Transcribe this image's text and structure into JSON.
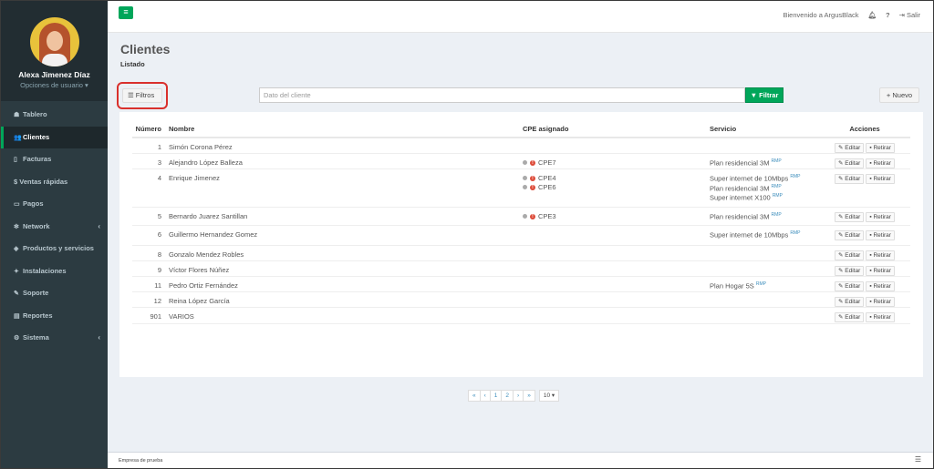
{
  "user": {
    "name": "Alexa Jimenez Díaz",
    "options_label": "Opciones de usuario ▾"
  },
  "sidebar": {
    "items": [
      {
        "label": "Tablero",
        "icon": "dashboard-icon",
        "glyph": "☗"
      },
      {
        "label": "Clientes",
        "icon": "users-icon",
        "glyph": "👥",
        "active": true
      },
      {
        "label": "Facturas",
        "icon": "file-icon",
        "glyph": "▯"
      },
      {
        "label": "$ Ventas rápidas",
        "icon": "",
        "glyph": ""
      },
      {
        "label": "Pagos",
        "icon": "money-icon",
        "glyph": "▭"
      },
      {
        "label": "Network",
        "icon": "network-icon",
        "glyph": "✻",
        "chevron": "‹"
      },
      {
        "label": "Productos y servicios",
        "icon": "tag-icon",
        "glyph": "◈"
      },
      {
        "label": "Instalaciones",
        "icon": "plug-icon",
        "glyph": "✦"
      },
      {
        "label": "Soporte",
        "icon": "wrench-icon",
        "glyph": "✎"
      },
      {
        "label": "Reportes",
        "icon": "report-icon",
        "glyph": "▤"
      },
      {
        "label": "Sistema",
        "icon": "cogs-icon",
        "glyph": "⚙",
        "chevron": "‹"
      }
    ]
  },
  "header": {
    "menu_glyph": "≡",
    "welcome": "Bienvenido a ArgusBlack",
    "logout": "Salir"
  },
  "page": {
    "title": "Clientes",
    "subtitle": "Listado"
  },
  "toolbar": {
    "filtros_label": "☰ Filtros",
    "search_placeholder": "Dato del cliente",
    "filtrar_label": "▼ Filtrar",
    "nuevo_label": "+ Nuevo"
  },
  "table": {
    "headers": {
      "numero": "Número",
      "nombre": "Nombre",
      "cpe": "CPE asignado",
      "servicio": "Servicio",
      "acciones": "Acciones"
    },
    "edit_label": "✎ Editar",
    "remove_label": "▪ Retirar",
    "rmp": "RMP",
    "rows": [
      {
        "num": "1",
        "name": "Simón Corona Pérez",
        "cpe": [],
        "services": []
      },
      {
        "num": "3",
        "name": "Alejandro López Balleza",
        "cpe": [
          "CPE7"
        ],
        "services": [
          "Plan residencial 3M"
        ]
      },
      {
        "num": "4",
        "name": "Enrique Jimenez",
        "cpe": [
          "CPE4",
          "CPE6"
        ],
        "services": [
          "Super internet de 10Mbps",
          "Plan residencial 3M",
          "Super internet X100"
        ]
      },
      {
        "num": "5",
        "name": "Bernardo Juarez Santillan",
        "cpe": [
          "CPE3"
        ],
        "services": [
          "Plan residencial 3M"
        ]
      },
      {
        "num": "6",
        "name": "Guillermo Hernandez Gomez",
        "cpe": [],
        "services": [
          "Super internet de 10Mbps"
        ]
      },
      {
        "num": "8",
        "name": "Gonzalo Mendez Robles",
        "cpe": [],
        "services": []
      },
      {
        "num": "9",
        "name": "Víctor Flores Núñez",
        "cpe": [],
        "services": []
      },
      {
        "num": "11",
        "name": "Pedro Ortiz Fernández",
        "cpe": [],
        "services": [
          "Plan Hogar 5S"
        ]
      },
      {
        "num": "12",
        "name": "Reina López García",
        "cpe": [],
        "services": []
      },
      {
        "num": "901",
        "name": "VARIOS",
        "cpe": [],
        "services": []
      }
    ]
  },
  "pagination": {
    "first": "«",
    "prev": "‹",
    "pages": [
      "1",
      "2"
    ],
    "next": "›",
    "last": "»",
    "per_page": "10 ▾"
  },
  "footer": {
    "text": "Empresa de prueba"
  }
}
